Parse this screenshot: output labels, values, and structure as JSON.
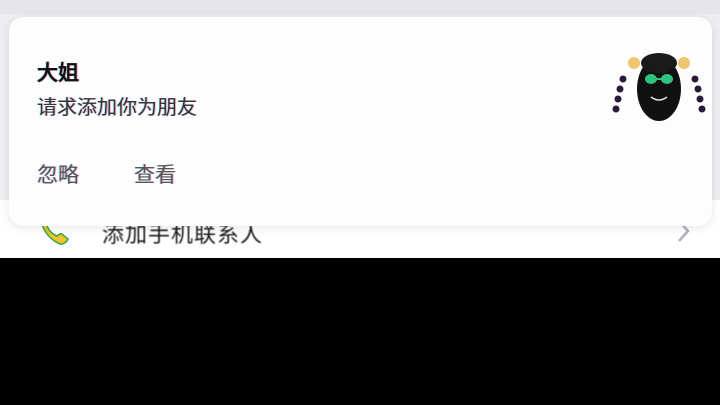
{
  "notification": {
    "sender_name": "大姐",
    "message": "请求添加你为朋友",
    "actions": {
      "ignore_label": "忽略",
      "view_label": "查看"
    },
    "avatar_icon": "avatar-photo"
  },
  "background_list": {
    "row_label": "添加手机联系人",
    "row_icon": "phone-icon",
    "row_chevron": "chevron-right-icon"
  },
  "colors": {
    "card_bg": "#fdfdfd",
    "screen_bg": "#eeeef0",
    "phone_icon_green": "#f2c230"
  }
}
